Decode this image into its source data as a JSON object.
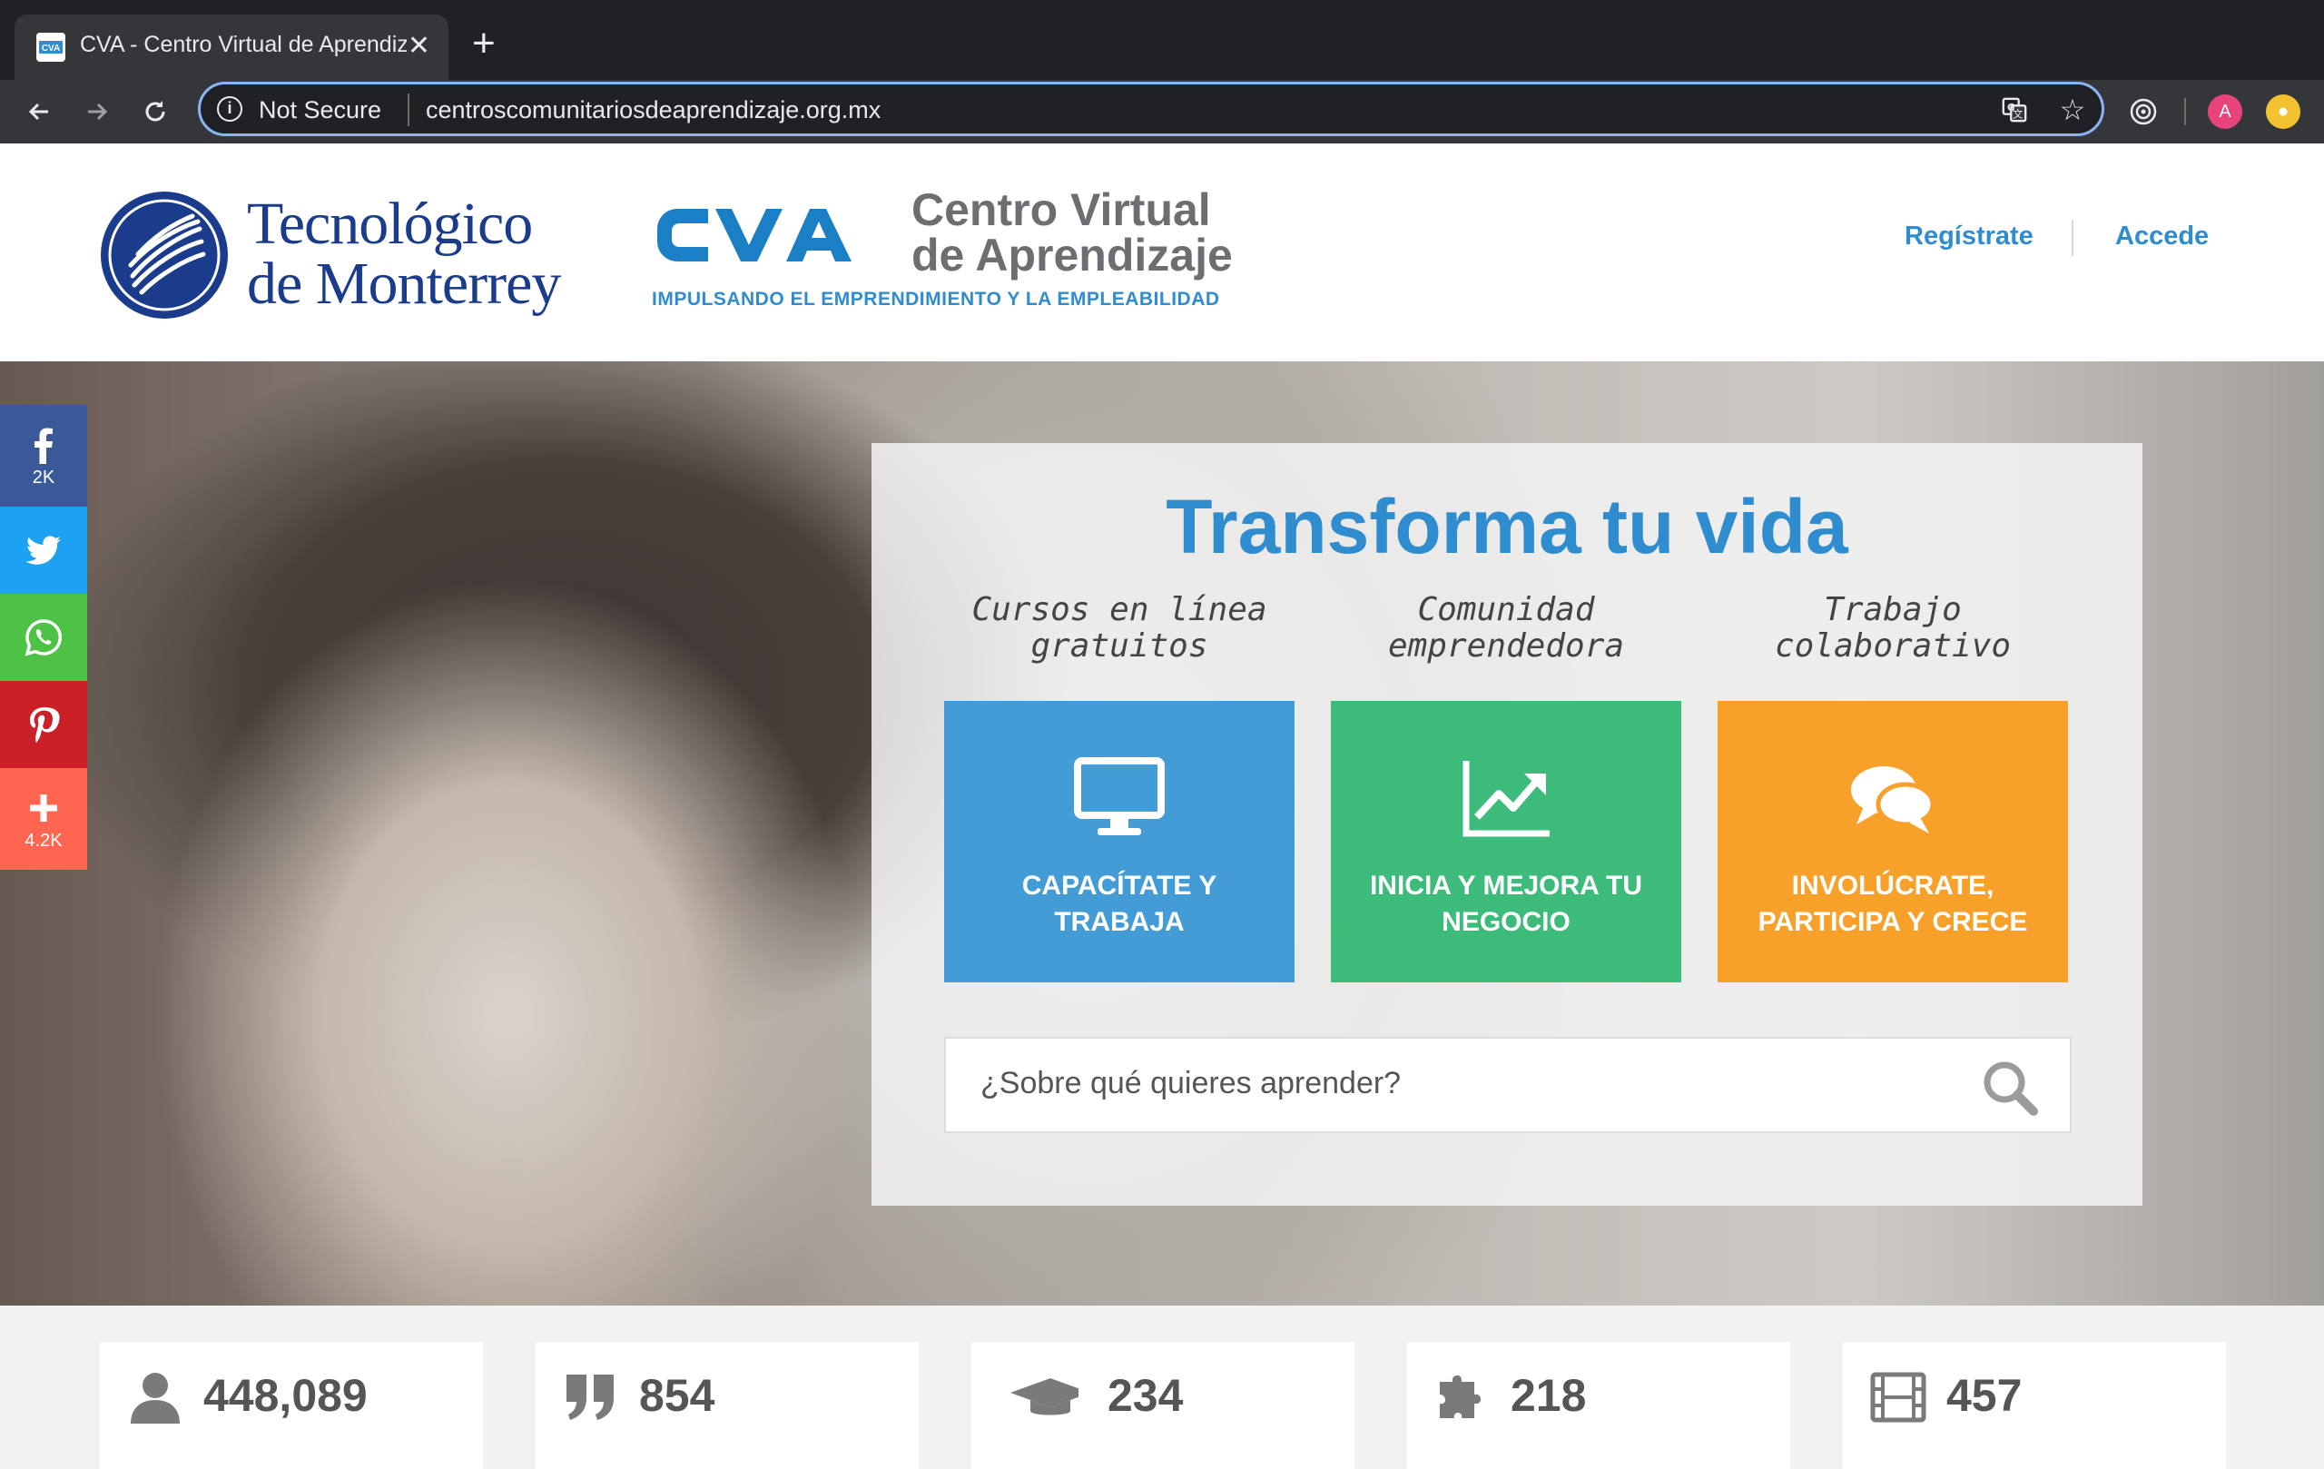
{
  "browser": {
    "tab_title": "CVA - Centro Virtual de Aprendizaje",
    "security_label": "Not Secure",
    "url": "centroscomunitariosdeaprendizaje.org.mx",
    "profile_initial": "A"
  },
  "header": {
    "tec_logo_text": "Tecnológico de Monterrey",
    "cva_title_line1": "Centro Virtual",
    "cva_title_line2": "de Aprendizaje",
    "cva_tagline": "IMPULSANDO EL EMPRENDIMIENTO Y LA EMPLEABILIDAD",
    "register_label": "Regístrate",
    "login_label": "Accede"
  },
  "social": [
    {
      "network": "facebook",
      "count": "2K",
      "color": "#3b5998"
    },
    {
      "network": "twitter",
      "count": "",
      "color": "#1da1f2"
    },
    {
      "network": "whatsapp",
      "count": "",
      "color": "#4dc247"
    },
    {
      "network": "pinterest",
      "count": "",
      "color": "#cb2027"
    },
    {
      "network": "more",
      "count": "4.2K",
      "color": "#ff6550"
    }
  ],
  "hero": {
    "title": "Transforma tu vida",
    "features": [
      {
        "caption_line1": "Cursos en línea",
        "caption_line2": "gratuitos",
        "label_line1": "CAPACÍTATE Y",
        "label_line2": "TRABAJA",
        "icon": "monitor-icon",
        "color": "#449cd6"
      },
      {
        "caption_line1": "Comunidad",
        "caption_line2": "emprendedora",
        "label_line1": "INICIA Y MEJORA TU",
        "label_line2": "NEGOCIO",
        "icon": "chart-up-icon",
        "color": "#3dbb7b"
      },
      {
        "caption_line1": "Trabajo",
        "caption_line2": "colaborativo",
        "label_line1": "INVOLÚCRATE,",
        "label_line2": "PARTICIPA Y CRECE",
        "icon": "chat-bubbles-icon",
        "color": "#f7a12b"
      }
    ],
    "search_placeholder": "¿Sobre qué quieres aprender?"
  },
  "stats": [
    {
      "icon": "user-icon",
      "value": "448,089"
    },
    {
      "icon": "quote-icon",
      "value": "854"
    },
    {
      "icon": "graduation-cap-icon",
      "value": "234"
    },
    {
      "icon": "puzzle-icon",
      "value": "218"
    },
    {
      "icon": "film-icon",
      "value": "457"
    }
  ]
}
